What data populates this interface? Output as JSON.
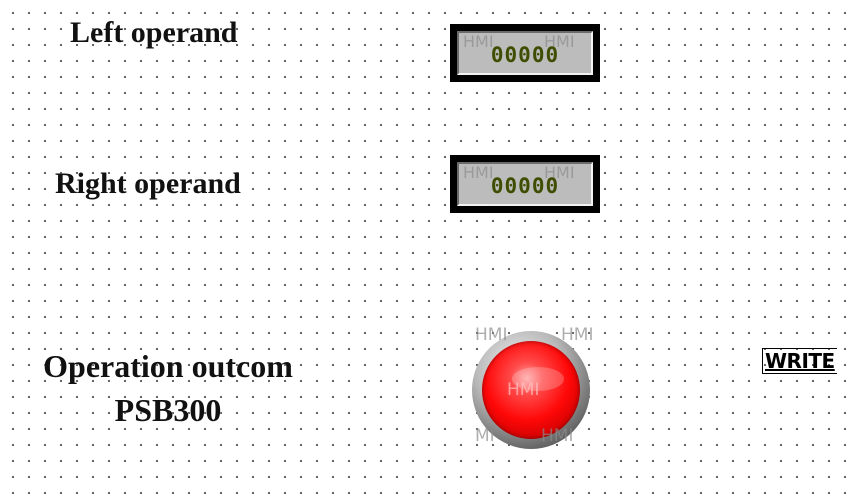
{
  "labels": {
    "left_operand": "Left operand",
    "right_operand": "Right  operand",
    "outcome_line1": "Operation outcom",
    "outcome_line2": "PSB300"
  },
  "numeric_displays": {
    "left": {
      "value": "00000",
      "watermark_a": "HMI",
      "watermark_b": "HMI"
    },
    "right": {
      "value": "00000",
      "watermark_a": "HMI",
      "watermark_b": "HMI"
    }
  },
  "indicator_lamp": {
    "state_color": "#ff0000",
    "wm_top_left": "HMI",
    "wm_top_right": "HMI",
    "wm_center": "HMI",
    "wm_bottom_left": "MI",
    "wm_bottom_right": "HMI"
  },
  "buttons": {
    "write_label": "WRITE"
  },
  "colors": {
    "grid_dot": "#555555",
    "display_text": "#3e4d00",
    "lamp_on": "#ff0000"
  }
}
